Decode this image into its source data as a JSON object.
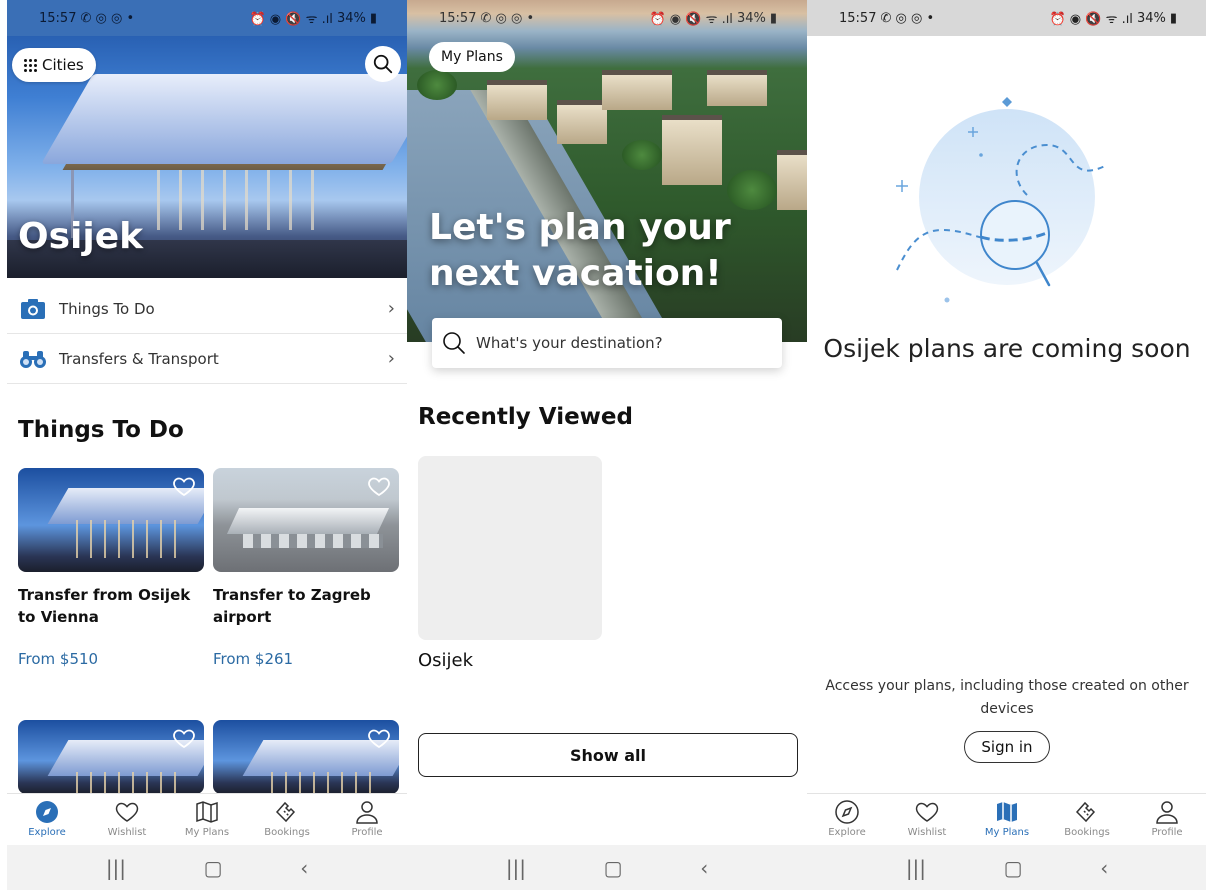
{
  "status": {
    "time": "15:57",
    "battery": "34%"
  },
  "explore": {
    "cities_label": "Cities",
    "city_name": "Osijek",
    "rows": [
      {
        "label": "Things To Do"
      },
      {
        "label": "Transfers & Transport"
      }
    ],
    "section_title": "Things To Do",
    "cards": [
      {
        "title": "Transfer from Osijek to Vienna",
        "price": "From $510"
      },
      {
        "title": "Transfer to Zagreb airport",
        "price": "From $261"
      }
    ]
  },
  "plans": {
    "my_plans_label": "My Plans",
    "hero_title": "Let's plan your next vacation!",
    "search_placeholder": "What's your destination?",
    "recent_title": "Recently Viewed",
    "recent_item": "Osijek",
    "show_all": "Show all"
  },
  "plans_empty": {
    "coming_soon": "Osijek plans are coming soon",
    "access_text": "Access your plans, including those created on other devices",
    "sign_in": "Sign in"
  },
  "tabs": [
    {
      "label": "Explore",
      "icon": "compass-icon"
    },
    {
      "label": "Wishlist",
      "icon": "heart-icon"
    },
    {
      "label": "My Plans",
      "icon": "map-icon"
    },
    {
      "label": "Bookings",
      "icon": "ticket-icon"
    },
    {
      "label": "Profile",
      "icon": "person-icon"
    }
  ],
  "colors": {
    "accent": "#2a6fb7",
    "price": "#2b6aa3"
  }
}
